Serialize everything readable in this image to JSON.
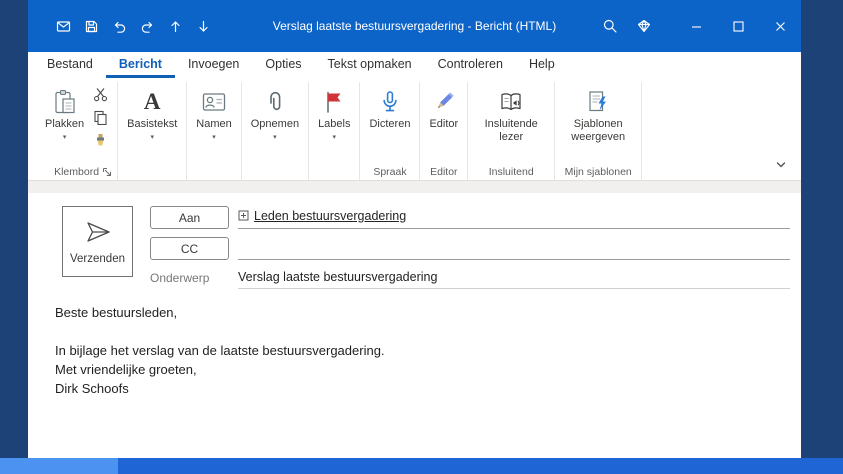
{
  "colors": {
    "titlebar_blue": "#0d64c8",
    "active_tab_blue": "#1160b8",
    "desktop_blue": "#1d4278",
    "bottom_bar_blue": "#2065d6",
    "bottom_bar_light_blue": "#4c92f0",
    "flag_red": "#d13438",
    "ribbon_icon_blue": "#2b7cd3"
  },
  "titlebar": {
    "title": "Verslag laatste bestuursvergadering  -  Bericht (HTML)",
    "qat_icons": [
      "message-icon",
      "save-icon",
      "undo-icon",
      "redo-icon",
      "previous-item-icon",
      "next-item-icon"
    ],
    "right_icons": [
      "search-icon",
      "gem-icon",
      "minimize-icon",
      "maximize-icon",
      "close-icon"
    ]
  },
  "tabs": [
    {
      "label": "Bestand",
      "active": false
    },
    {
      "label": "Bericht",
      "active": true
    },
    {
      "label": "Invoegen",
      "active": false
    },
    {
      "label": "Opties",
      "active": false
    },
    {
      "label": "Tekst opmaken",
      "active": false
    },
    {
      "label": "Controleren",
      "active": false
    },
    {
      "label": "Help",
      "active": false
    }
  ],
  "ribbon": {
    "collapse_icon": "chevron-down-icon",
    "groups": [
      {
        "label": "Klembord",
        "dialog_launcher": true,
        "buttons": [
          {
            "label": "Plakken",
            "icon": "clipboard-paste-icon",
            "dropdown": true
          }
        ],
        "small_buttons": [
          {
            "icon": "cut-icon"
          },
          {
            "icon": "copy-icon"
          },
          {
            "icon": "format-painter-icon"
          }
        ]
      },
      {
        "label": "",
        "buttons": [
          {
            "label": "Basistekst",
            "icon": "font-icon",
            "dropdown": true
          }
        ]
      },
      {
        "label": "",
        "buttons": [
          {
            "label": "Namen",
            "icon": "contact-card-icon",
            "dropdown": true
          }
        ]
      },
      {
        "label": "",
        "buttons": [
          {
            "label": "Opnemen",
            "icon": "paperclip-icon",
            "dropdown": true
          }
        ]
      },
      {
        "label": "",
        "buttons": [
          {
            "label": "Labels",
            "icon": "flag-icon",
            "dropdown": true
          }
        ]
      },
      {
        "label": "Spraak",
        "buttons": [
          {
            "label": "Dicteren",
            "icon": "microphone-icon",
            "dropdown": false
          }
        ]
      },
      {
        "label": "Editor",
        "buttons": [
          {
            "label": "Editor",
            "icon": "editor-pencil-icon",
            "dropdown": false
          }
        ]
      },
      {
        "label": "Insluitend",
        "buttons": [
          {
            "label": "Insluitende lezer",
            "icon": "immersive-reader-icon",
            "dropdown": false
          }
        ]
      },
      {
        "label": "Mijn sjablonen",
        "buttons": [
          {
            "label": "Sjablonen weergeven",
            "icon": "templates-lightning-icon",
            "dropdown": false
          }
        ]
      }
    ]
  },
  "compose": {
    "send_button": "Verzenden",
    "to_button": "Aan",
    "cc_button": "CC",
    "subject_label": "Onderwerp",
    "to_recipient": "Leden bestuursvergadering",
    "expand_icon": "expand-group-icon",
    "subject_value": "Verslag laatste bestuursvergadering",
    "body_lines": [
      "Beste bestuursleden,",
      "",
      "In bijlage het verslag van de laatste bestuursvergadering.",
      "Met vriendelijke groeten,",
      "Dirk Schoofs"
    ]
  }
}
